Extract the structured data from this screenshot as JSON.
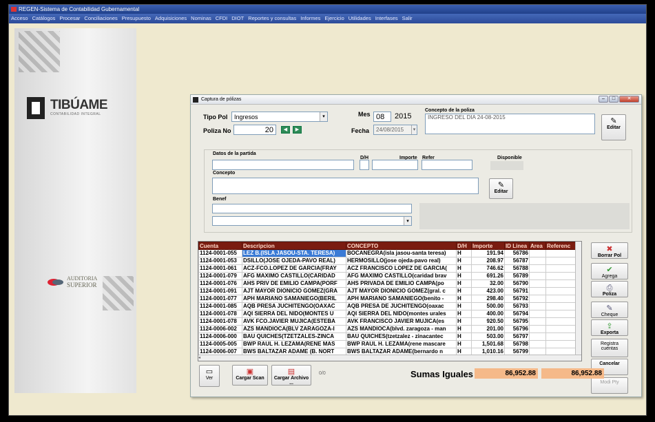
{
  "app": {
    "title": "REGEN-Sistema de Contabilidad Gubernamental",
    "menu": [
      "Acceso",
      "Catálogos",
      "Procesar",
      "Conciliaciones",
      "Presupuesto",
      "Adquisiciones",
      "Nominas",
      "CFDI",
      "DIOT",
      "Reportes y consultas",
      "Informes",
      "Ejercicio",
      "Utilidades",
      "Interfases",
      "Salir"
    ]
  },
  "sidebar": {
    "logo_name": "TIBÚAME",
    "logo_sub": "CONTABILIDAD INTEGRAL",
    "auditoria_line1": "AUDITORIA",
    "auditoria_line2": "SUPERIOR"
  },
  "dialog": {
    "title": "Captura de pólizas",
    "header": {
      "tipo_pol_label": "Tipo Pol",
      "tipo_pol_value": "Ingresos",
      "poliza_no_label": "Poliza No",
      "poliza_no_value": "20",
      "mes_label": "Mes",
      "mes_value": "08",
      "anio_value": "2015",
      "fecha_label": "Fecha",
      "fecha_value": "24/08/2015",
      "concepto_poliza_label": "Concepto de la poliza",
      "concepto_poliza_value": "INGRESO DEL DIA 24-08-2015",
      "editar_label": "Editar"
    },
    "partida": {
      "section_label": "Datos de la partida",
      "dh_label": "D/H",
      "importe_label": "Importe",
      "refer_label": "Refer",
      "disponible_label": "Disponible",
      "concepto_label": "Concepto",
      "editar_label": "Editar",
      "benef_label": "Benef"
    },
    "grid": {
      "columns": [
        "Cuenta",
        "Descripcion",
        "CONCEPTO",
        "D/H",
        "Importe",
        "ID Linea",
        "Area",
        "Referenc"
      ],
      "rows": [
        [
          "1124-0001-055",
          "LEZ B.(ISLA JASOU-STA. TERESA)",
          "BOCANEGRA(isla jasou-santa teresa)",
          "H",
          "191.94",
          "56786",
          "",
          ""
        ],
        [
          "1124-0001-053",
          "DSILLO(JOSE OJEDA-PAVO REAL)",
          "HERMOSILLO(jose ojeda-pavo real)",
          "H",
          "208.97",
          "56787",
          "",
          ""
        ],
        [
          "1124-0001-061",
          "ACZ-FCO.LOPEZ DE GARCIA(FRAY",
          "ACZ FRANCISCO LOPEZ DE GARCIA(",
          "H",
          "746.62",
          "56788",
          "",
          ""
        ],
        [
          "1124-0001-079",
          "AFG MAXIMO CASTILLO(CARIDAD",
          "AFG MAXIMO CASTILLO(caridad brav",
          "H",
          "691.26",
          "56789",
          "",
          ""
        ],
        [
          "1124-0001-076",
          "AHS PRIV DE EMILIO CAMPA(PORF",
          "AHS PRIVADA DE EMILIO CAMPA(po",
          "H",
          "32.00",
          "56790",
          "",
          ""
        ],
        [
          "1124-0001-091",
          "AJT MAYOR DIONICIO GOMEZ(GRA",
          "AJT MAYOR DIONICIO GOMEZ(gral. c",
          "H",
          "423.00",
          "56791",
          "",
          ""
        ],
        [
          "1124-0001-077",
          "APH MARIANO SAMANIEGO(BERIL",
          "APH MARIANO SAMANIEGO(benito -",
          "H",
          "298.40",
          "56792",
          "",
          ""
        ],
        [
          "1124-0001-085",
          "AQB PRESA JUCHITENGO(OAXAC",
          "AQB PRESA DE JUCHITENGO(oaxac",
          "H",
          "500.00",
          "56793",
          "",
          ""
        ],
        [
          "1124-0001-078",
          "AQI SIERRA DEL NIDO(MONTES U",
          "AQI SIERRA DEL NIDO(montes urales",
          "H",
          "400.00",
          "56794",
          "",
          ""
        ],
        [
          "1124-0001-078",
          "AVK FCO.JAVIER MUJICA(ESTEBA",
          "AVK FRANCISCO JAVIER MUJICA(es",
          "H",
          "920.50",
          "56795",
          "",
          ""
        ],
        [
          "1124-0006-002",
          "AZS MANDIOCA(BLV ZARAGOZA-I",
          "AZS MANDIOCA(blvd. zaragoza - man",
          "H",
          "201.00",
          "56796",
          "",
          ""
        ],
        [
          "1124-0006-000",
          "BAU QUICHES(TZETZALES-ZINCA",
          "BAU QUICHES(tzetzalez - zinacantec",
          "H",
          "503.00",
          "56797",
          "",
          ""
        ],
        [
          "1124-0005-005",
          "BWP RAUL H. LEZAMA(RENE MAS",
          "BWP RAUL H. LEZAMA(rene mascare",
          "H",
          "1,501.68",
          "56798",
          "",
          ""
        ],
        [
          "1124-0006-007",
          "BWS BALTAZAR ADAME (B. NORT",
          "BWS BALTAZAR ADAME(bernardo n",
          "H",
          "1,010.16",
          "56799",
          "",
          ""
        ]
      ]
    },
    "side_buttons": [
      {
        "icon": "✖",
        "label": "Borrar Pol"
      },
      {
        "icon": "✔",
        "label": "Agrega"
      },
      {
        "icon": "⎙",
        "label": "Poliza"
      },
      {
        "icon": "✎",
        "label": "Cheque"
      },
      {
        "icon": "⇪",
        "label": "Exporta"
      },
      {
        "icon": "",
        "label": "Registra cuentas"
      },
      {
        "icon": "",
        "label": "Cancelar"
      },
      {
        "icon": "",
        "label": "Modi Pty"
      }
    ],
    "bottom": {
      "ver_label": "Ver",
      "cargar_scan_label": "Cargar Scan",
      "cargar_archivo_label": "Cargar Archivo ...",
      "counter": "0/0",
      "sumas_label": "Sumas Iguales",
      "sum_debe": "86,952.88",
      "sum_haber": "86,952.88"
    }
  }
}
